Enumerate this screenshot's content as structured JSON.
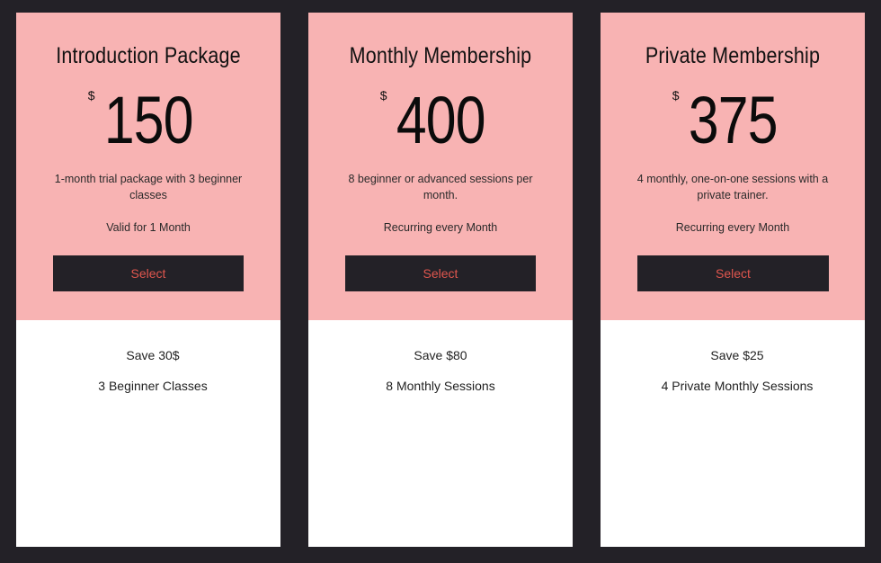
{
  "plans": [
    {
      "title": "Introduction Package",
      "currency": "$",
      "price": "150",
      "description": "1-month trial package with 3 beginner classes",
      "validity": "Valid for 1 Month",
      "button_label": "Select",
      "perks": [
        "Save 30$",
        "3 Beginner Classes"
      ]
    },
    {
      "title": "Monthly Membership",
      "currency": "$",
      "price": "400",
      "description": "8 beginner or advanced sessions per month.",
      "validity": "Recurring every Month",
      "button_label": "Select",
      "perks": [
        "Save $80",
        "8 Monthly Sessions"
      ]
    },
    {
      "title": "Private Membership",
      "currency": "$",
      "price": "375",
      "description": "4 monthly, one-on-one sessions with a private trainer.",
      "validity": "Recurring every Month",
      "button_label": "Select",
      "perks": [
        "Save $25",
        "4 Private Monthly Sessions"
      ]
    }
  ],
  "colors": {
    "page_background": "#232127",
    "card_header": "#f8b3b3",
    "card_body": "#ffffff",
    "button_background": "#232127",
    "button_text": "#e0564e"
  }
}
